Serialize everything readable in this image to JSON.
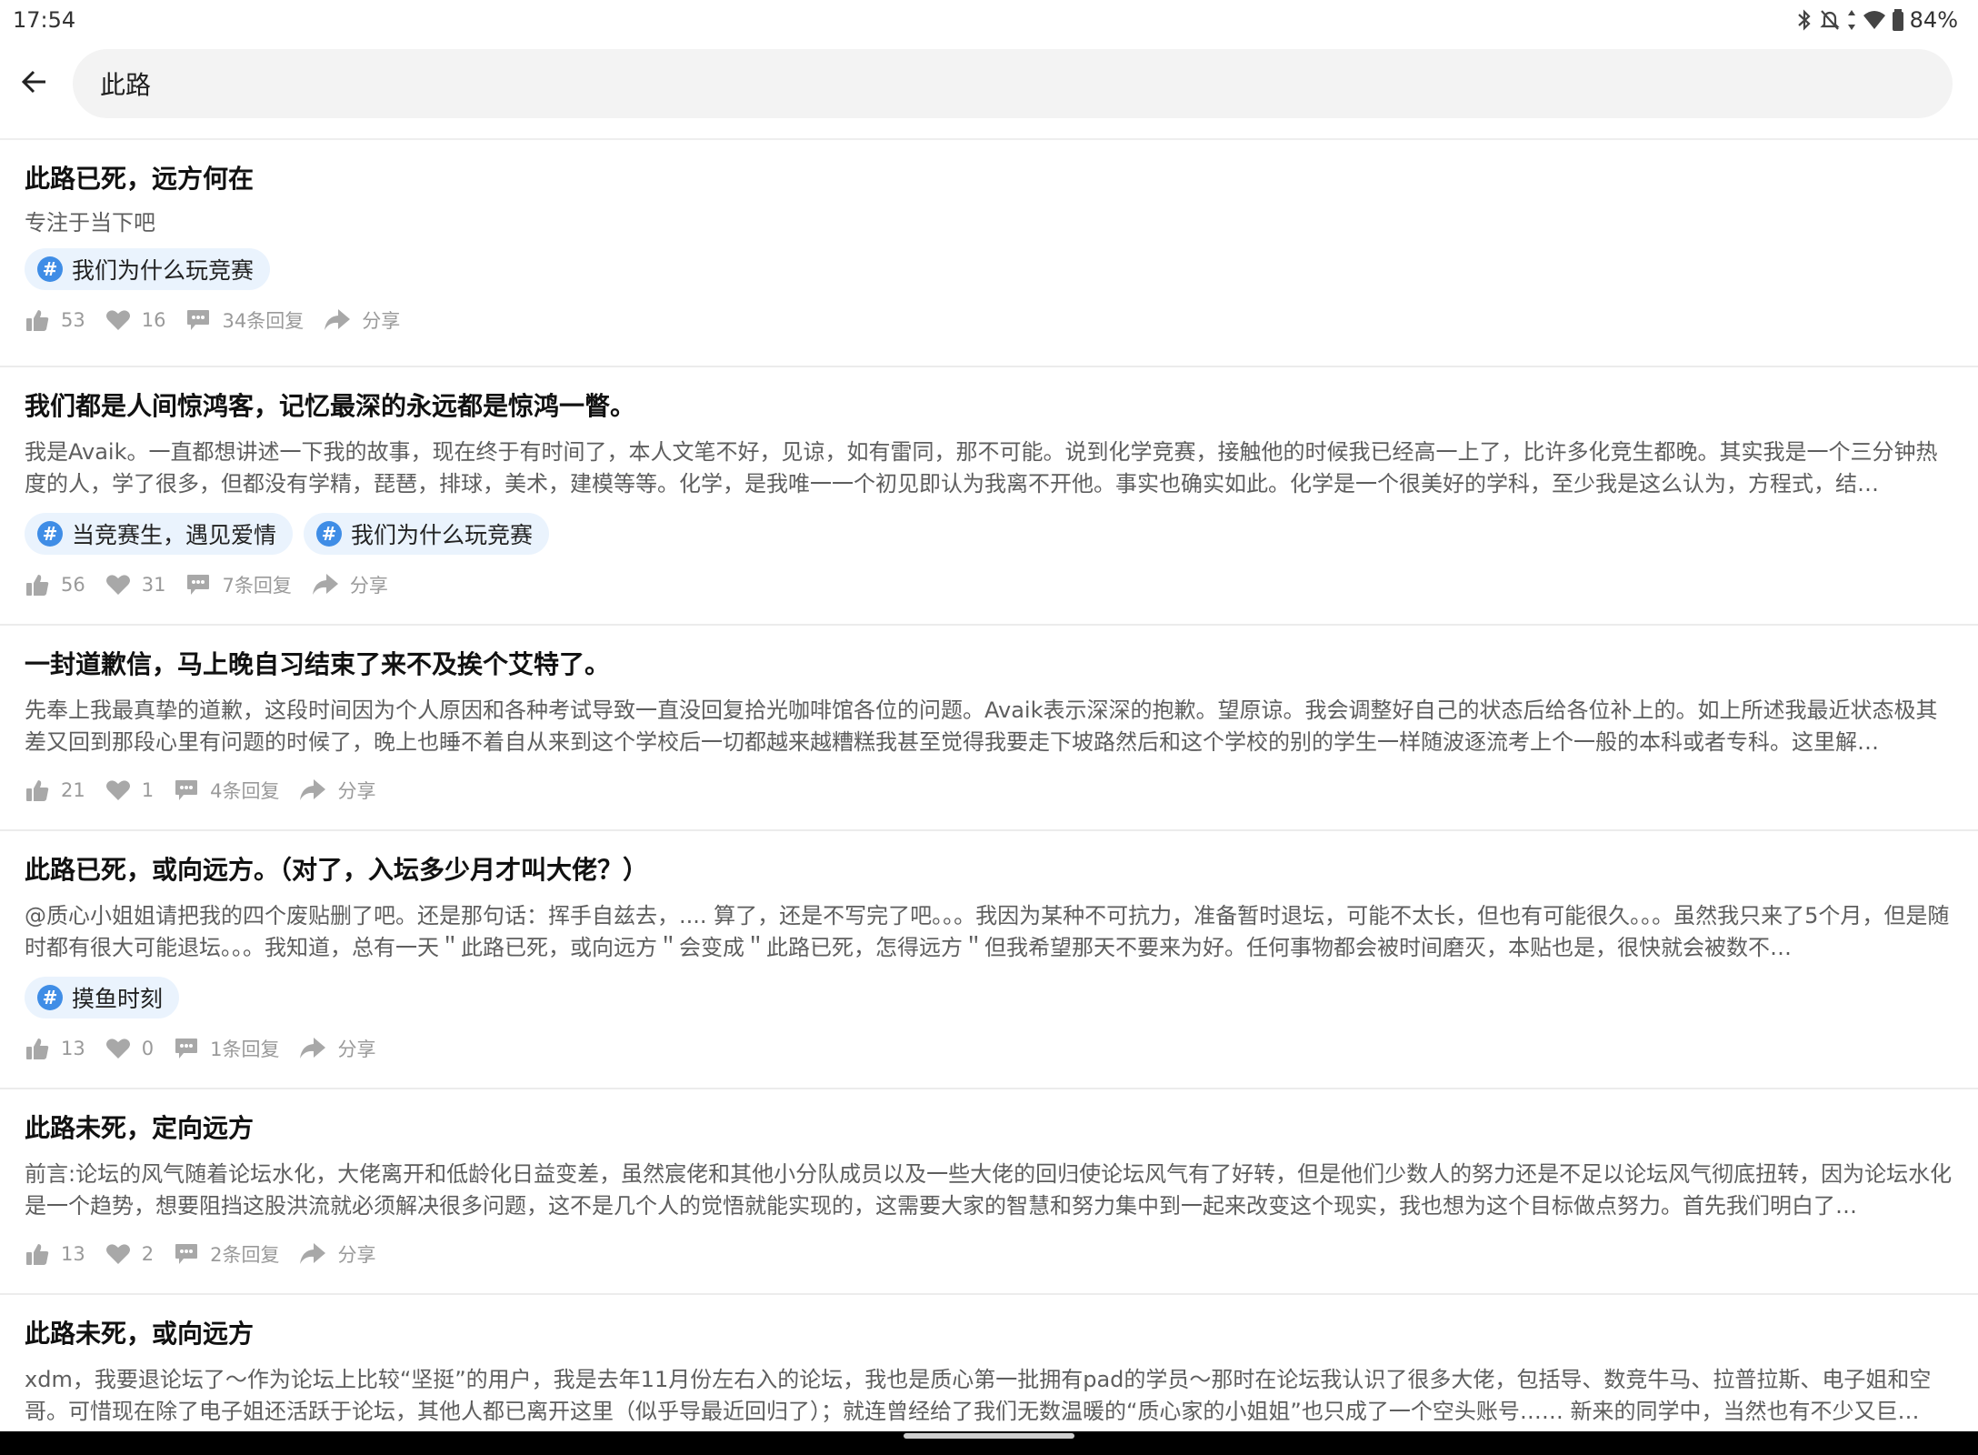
{
  "status_bar": {
    "time": "17:54",
    "battery": "84%"
  },
  "search": {
    "query": "此路"
  },
  "posts": [
    {
      "title": "此路已死，远方何在",
      "excerpt": "专注于当下吧",
      "tags": [
        "我们为什么玩竞赛"
      ],
      "likes": "53",
      "favorites": "16",
      "replies": "34条回复",
      "share": "分享"
    },
    {
      "title": "我们都是人间惊鸿客，记忆最深的永远都是惊鸿一瞥。",
      "excerpt": "我是Avaik。一直都想讲述一下我的故事，现在终于有时间了，本人文笔不好，见谅，如有雷同，那不可能。说到化学竞赛，接触他的时候我已经高一上了，比许多化竞生都晚。其实我是一个三分钟热度的人，学了很多，但都没有学精，琵琶，排球，美术，建模等等。化学，是我唯一一个初见即认为我离不开他。事实也确实如此。化学是一个很美好的学科，至少我是这么认为，方程式，结…",
      "tags": [
        "当竞赛生，遇见爱情",
        "我们为什么玩竞赛"
      ],
      "likes": "56",
      "favorites": "31",
      "replies": "7条回复",
      "share": "分享"
    },
    {
      "title": "一封道歉信，马上晚自习结束了来不及挨个艾特了。",
      "excerpt": "先奉上我最真挚的道歉，这段时间因为个人原因和各种考试导致一直没回复拾光咖啡馆各位的问题。Avaik表示深深的抱歉。望原谅。我会调整好自己的状态后给各位补上的。如上所述我最近状态极其差又回到那段心里有问题的时候了，晚上也睡不着自从来到这个学校后一切都越来越糟糕我甚至觉得我要走下坡路然后和这个学校的别的学生一样随波逐流考上个一般的本科或者专科。这里解…",
      "tags": [],
      "likes": "21",
      "favorites": "1",
      "replies": "4条回复",
      "share": "分享"
    },
    {
      "title": "此路已死，或向远方。（对了，入坛多少月才叫大佬？）",
      "excerpt": "@质心小姐姐请把我的四个废贴删了吧。还是那句话：挥手自兹去，.... 算了，还是不写完了吧。。。我因为某种不可抗力，准备暂时退坛，可能不太长，但也有可能很久。。。虽然我只来了5个月，但是随时都有很大可能退坛。。。我知道，总有一天＂此路已死，或向远方＂会变成＂此路已死，怎得远方＂但我希望那天不要来为好。任何事物都会被时间磨灭，本贴也是，很快就会被数不…",
      "tags": [
        "摸鱼时刻"
      ],
      "likes": "13",
      "favorites": "0",
      "replies": "1条回复",
      "share": "分享"
    },
    {
      "title": "此路未死，定向远方",
      "excerpt": "前言:论坛的风气随着论坛水化，大佬离开和低龄化日益变差，虽然宸佬和其他小分队成员以及一些大佬的回归使论坛风气有了好转，但是他们少数人的努力还是不足以论坛风气彻底扭转，因为论坛水化是一个趋势，想要阻挡这股洪流就必须解决很多问题，这不是几个人的觉悟就能实现的，这需要大家的智慧和努力集中到一起来改变这个现实，我也想为这个目标做点努力。首先我们明白了…",
      "tags": [],
      "likes": "13",
      "favorites": "2",
      "replies": "2条回复",
      "share": "分享"
    },
    {
      "title": "此路未死，或向远方",
      "excerpt": "xdm，我要退论坛了～作为论坛上比较“坚挺”的用户，我是去年11月份左右入的论坛，我也是质心第一批拥有pad的学员～那时在论坛我认识了很多大佬，包括导、数竞牛马、拉普拉斯、电子姐和空哥。可惜现在除了电子姐还活跃于论坛，其他人都已离开这里（似乎导最近回归了）；就连曾经给了我们无数温暖的“质心家的小姐姐”也只成了一个空头账号…… 新来的同学中，当然也有不少又巨…",
      "tags": [],
      "likes": "",
      "favorites": "",
      "replies": "",
      "share": ""
    }
  ]
}
